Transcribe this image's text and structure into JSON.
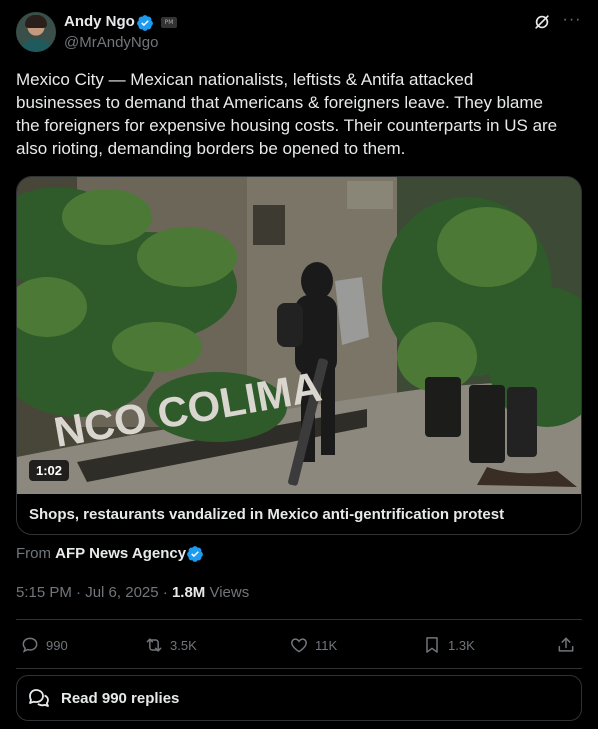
{
  "author": {
    "name": "Andy Ngo",
    "handle": "@MrAndyNgo",
    "badge_text": "PM"
  },
  "tweet": {
    "text": "Mexico City — Mexican nationalists, leftists & Antifa attacked\nbusinesses to demand that Americans & foreigners leave. They blame\nthe foreigners for expensive housing costs. Their counterparts in US are\nalso rioting, demanding borders be opened to them."
  },
  "media": {
    "duration": "1:02",
    "title": "Shops, restaurants vandalized in Mexico anti-gentrification protest",
    "sign_text": "NCO COLIMA"
  },
  "source": {
    "prefix": "From",
    "name": "AFP News Agency"
  },
  "meta": {
    "time": "5:15 PM",
    "separator": " · ",
    "date": "Jul 6, 2025",
    "views_count": "1.8M",
    "views_label": "Views"
  },
  "actions": {
    "replies": "990",
    "reposts": "3.5K",
    "likes": "11K",
    "bookmarks": "1.3K"
  },
  "read_replies": "Read 990 replies",
  "colors": {
    "background": "#000000",
    "text": "#e7e9ea",
    "muted": "#71767b",
    "border": "#2f3336",
    "verified_blue": "#1d9bf0"
  },
  "icons": [
    "verified-icon",
    "grok-icon",
    "more-icon",
    "reply-icon",
    "repost-icon",
    "like-icon",
    "bookmark-icon",
    "share-icon",
    "conversation-icon"
  ]
}
